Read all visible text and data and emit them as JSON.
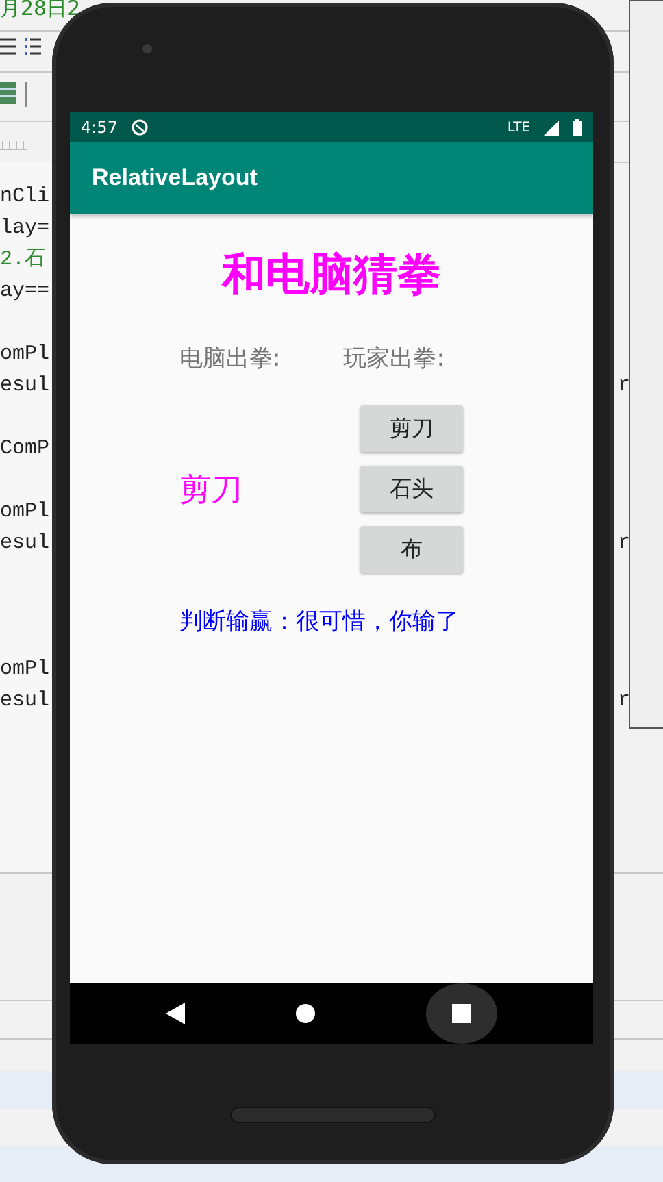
{
  "ide": {
    "date_fragment": "月28日2",
    "code_lines": [
      {
        "text": "nCli",
        "kind": "code"
      },
      {
        "text": "lay=",
        "kind": "code"
      },
      {
        "text": "2.石",
        "kind": "comment"
      },
      {
        "text": "ay==",
        "kind": "code"
      },
      {
        "text": "omPl",
        "kind": "code"
      },
      {
        "text": "esul",
        "kind": "code"
      },
      {
        "text": "ComP",
        "kind": "code"
      },
      {
        "text": "omPl",
        "kind": "code"
      },
      {
        "text": "esul",
        "kind": "code"
      },
      {
        "text": "omPl",
        "kind": "code"
      },
      {
        "text": "esul",
        "kind": "code"
      }
    ],
    "right_fragments": [
      "r",
      "r",
      "r"
    ]
  },
  "phone": {
    "status_bar": {
      "time": "4:57",
      "network": "LTE"
    },
    "app_bar": {
      "title": "RelativeLayout"
    },
    "content": {
      "title": "和电脑猜拳",
      "computer_label": "电脑出拳:",
      "player_label": "玩家出拳:",
      "computer_choice": "剪刀",
      "buttons": [
        "剪刀",
        "石头",
        "布"
      ],
      "result": "判断输赢：很可惜，你输了"
    }
  }
}
